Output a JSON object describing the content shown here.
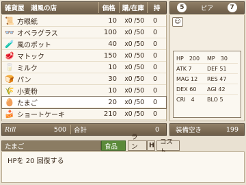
{
  "shop": {
    "title": "雑貨屋　潮風の店",
    "col_price": "価格",
    "col_stock": "購/在庫",
    "col_owned": "持"
  },
  "items": [
    {
      "icon": "paper-icon",
      "glyph": "📜",
      "name": "方眼紙",
      "price": "10",
      "stock": "x0 /50",
      "owned": "0"
    },
    {
      "icon": "glasses-icon",
      "glyph": "👓",
      "name": "オペラグラス",
      "price": "100",
      "stock": "x0 /50",
      "owned": "0"
    },
    {
      "icon": "potion-icon",
      "glyph": "🧪",
      "name": "風のポット",
      "price": "40",
      "stock": "x0 /50",
      "owned": "0"
    },
    {
      "icon": "meat-icon",
      "glyph": "🥩",
      "name": "マトック",
      "price": "150",
      "stock": "x0 /50",
      "owned": "0"
    },
    {
      "icon": "milk-icon",
      "glyph": "🥛",
      "name": "ミルク",
      "price": "10",
      "stock": "x0 /50",
      "owned": "0"
    },
    {
      "icon": "bread-icon",
      "glyph": "🍞",
      "name": "パン",
      "price": "30",
      "stock": "x0 /50",
      "owned": "0"
    },
    {
      "icon": "flour-icon",
      "glyph": "🌾",
      "name": "小麦粉",
      "price": "10",
      "stock": "x0 /50",
      "owned": "0"
    },
    {
      "icon": "egg-icon",
      "glyph": "🥚",
      "name": "たまご",
      "price": "20",
      "stock": "x0 /50",
      "owned": "0"
    },
    {
      "icon": "cake-icon",
      "glyph": "🍰",
      "name": "ショートケーキ",
      "price": "210",
      "stock": "x0 /50",
      "owned": "0"
    }
  ],
  "coins": {
    "left_count": "5",
    "label": "ピア",
    "right_count": "7"
  },
  "stats": {
    "hp": "HP　200",
    "mp": "MP　30",
    "atk": "ATK 7",
    "def": "DEF 51",
    "mag": "MAG 12",
    "res": "RES 47",
    "dex": "DEX 60",
    "agi": "AGI 42",
    "cri": "CRI　4",
    "blo": "BLO 5"
  },
  "money": {
    "label": "Rill",
    "value": "500",
    "sum_label": "合計",
    "sum_value": "0"
  },
  "capacity": {
    "label": "装備空き",
    "value": "199"
  },
  "detail": {
    "name": "たまご",
    "category": "食品",
    "rank_label": "ランク",
    "rank": "H",
    "cost_label": "コスト",
    "description": "HPを 20 回復する"
  },
  "colors": {
    "header_bg": "#7f6e57",
    "panel_bg": "#f6f1e7",
    "selected_row": "#ffffff",
    "category_green": "#5b8a3a"
  }
}
